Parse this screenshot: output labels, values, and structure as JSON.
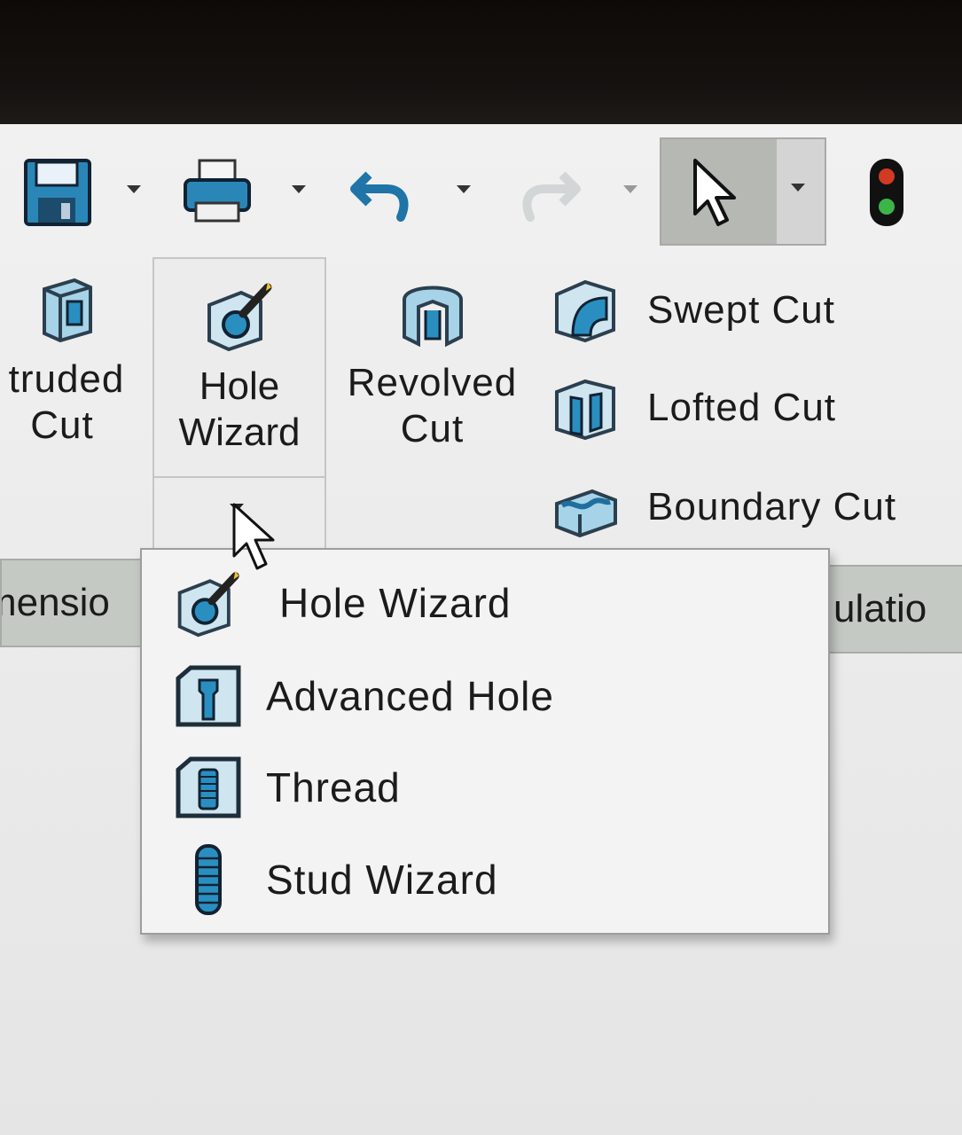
{
  "quick_access": {
    "items": [
      {
        "icon": "save-icon"
      },
      {
        "icon": "print-icon"
      },
      {
        "icon": "undo-icon"
      },
      {
        "icon": "redo-icon"
      },
      {
        "icon": "select-pointer-icon"
      },
      {
        "icon": "rebuild-traffic-light-icon"
      }
    ]
  },
  "ribbon": {
    "extruded_cut": {
      "line1": "truded",
      "line2": "Cut"
    },
    "hole_wizard": {
      "line1": "Hole",
      "line2": "Wizard"
    },
    "revolved_cut": {
      "line1": "Revolved",
      "line2": "Cut"
    },
    "swept_cut": "Swept Cut",
    "lofted_cut": "Lofted Cut",
    "boundary_cut": "Boundary Cut"
  },
  "tabs": {
    "left_partial": "mensio",
    "right_partial": "ulatio"
  },
  "menu": {
    "items": [
      {
        "label": "Hole Wizard",
        "icon": "hole-wizard-icon"
      },
      {
        "label": "Advanced Hole",
        "icon": "advanced-hole-icon"
      },
      {
        "label": "Thread",
        "icon": "thread-icon"
      },
      {
        "label": "Stud Wizard",
        "icon": "stud-wizard-icon"
      }
    ]
  },
  "colors": {
    "icon_blue": "#2a8fc0",
    "icon_dark": "#1d3d55",
    "tab_bg": "#c5c9c3"
  }
}
